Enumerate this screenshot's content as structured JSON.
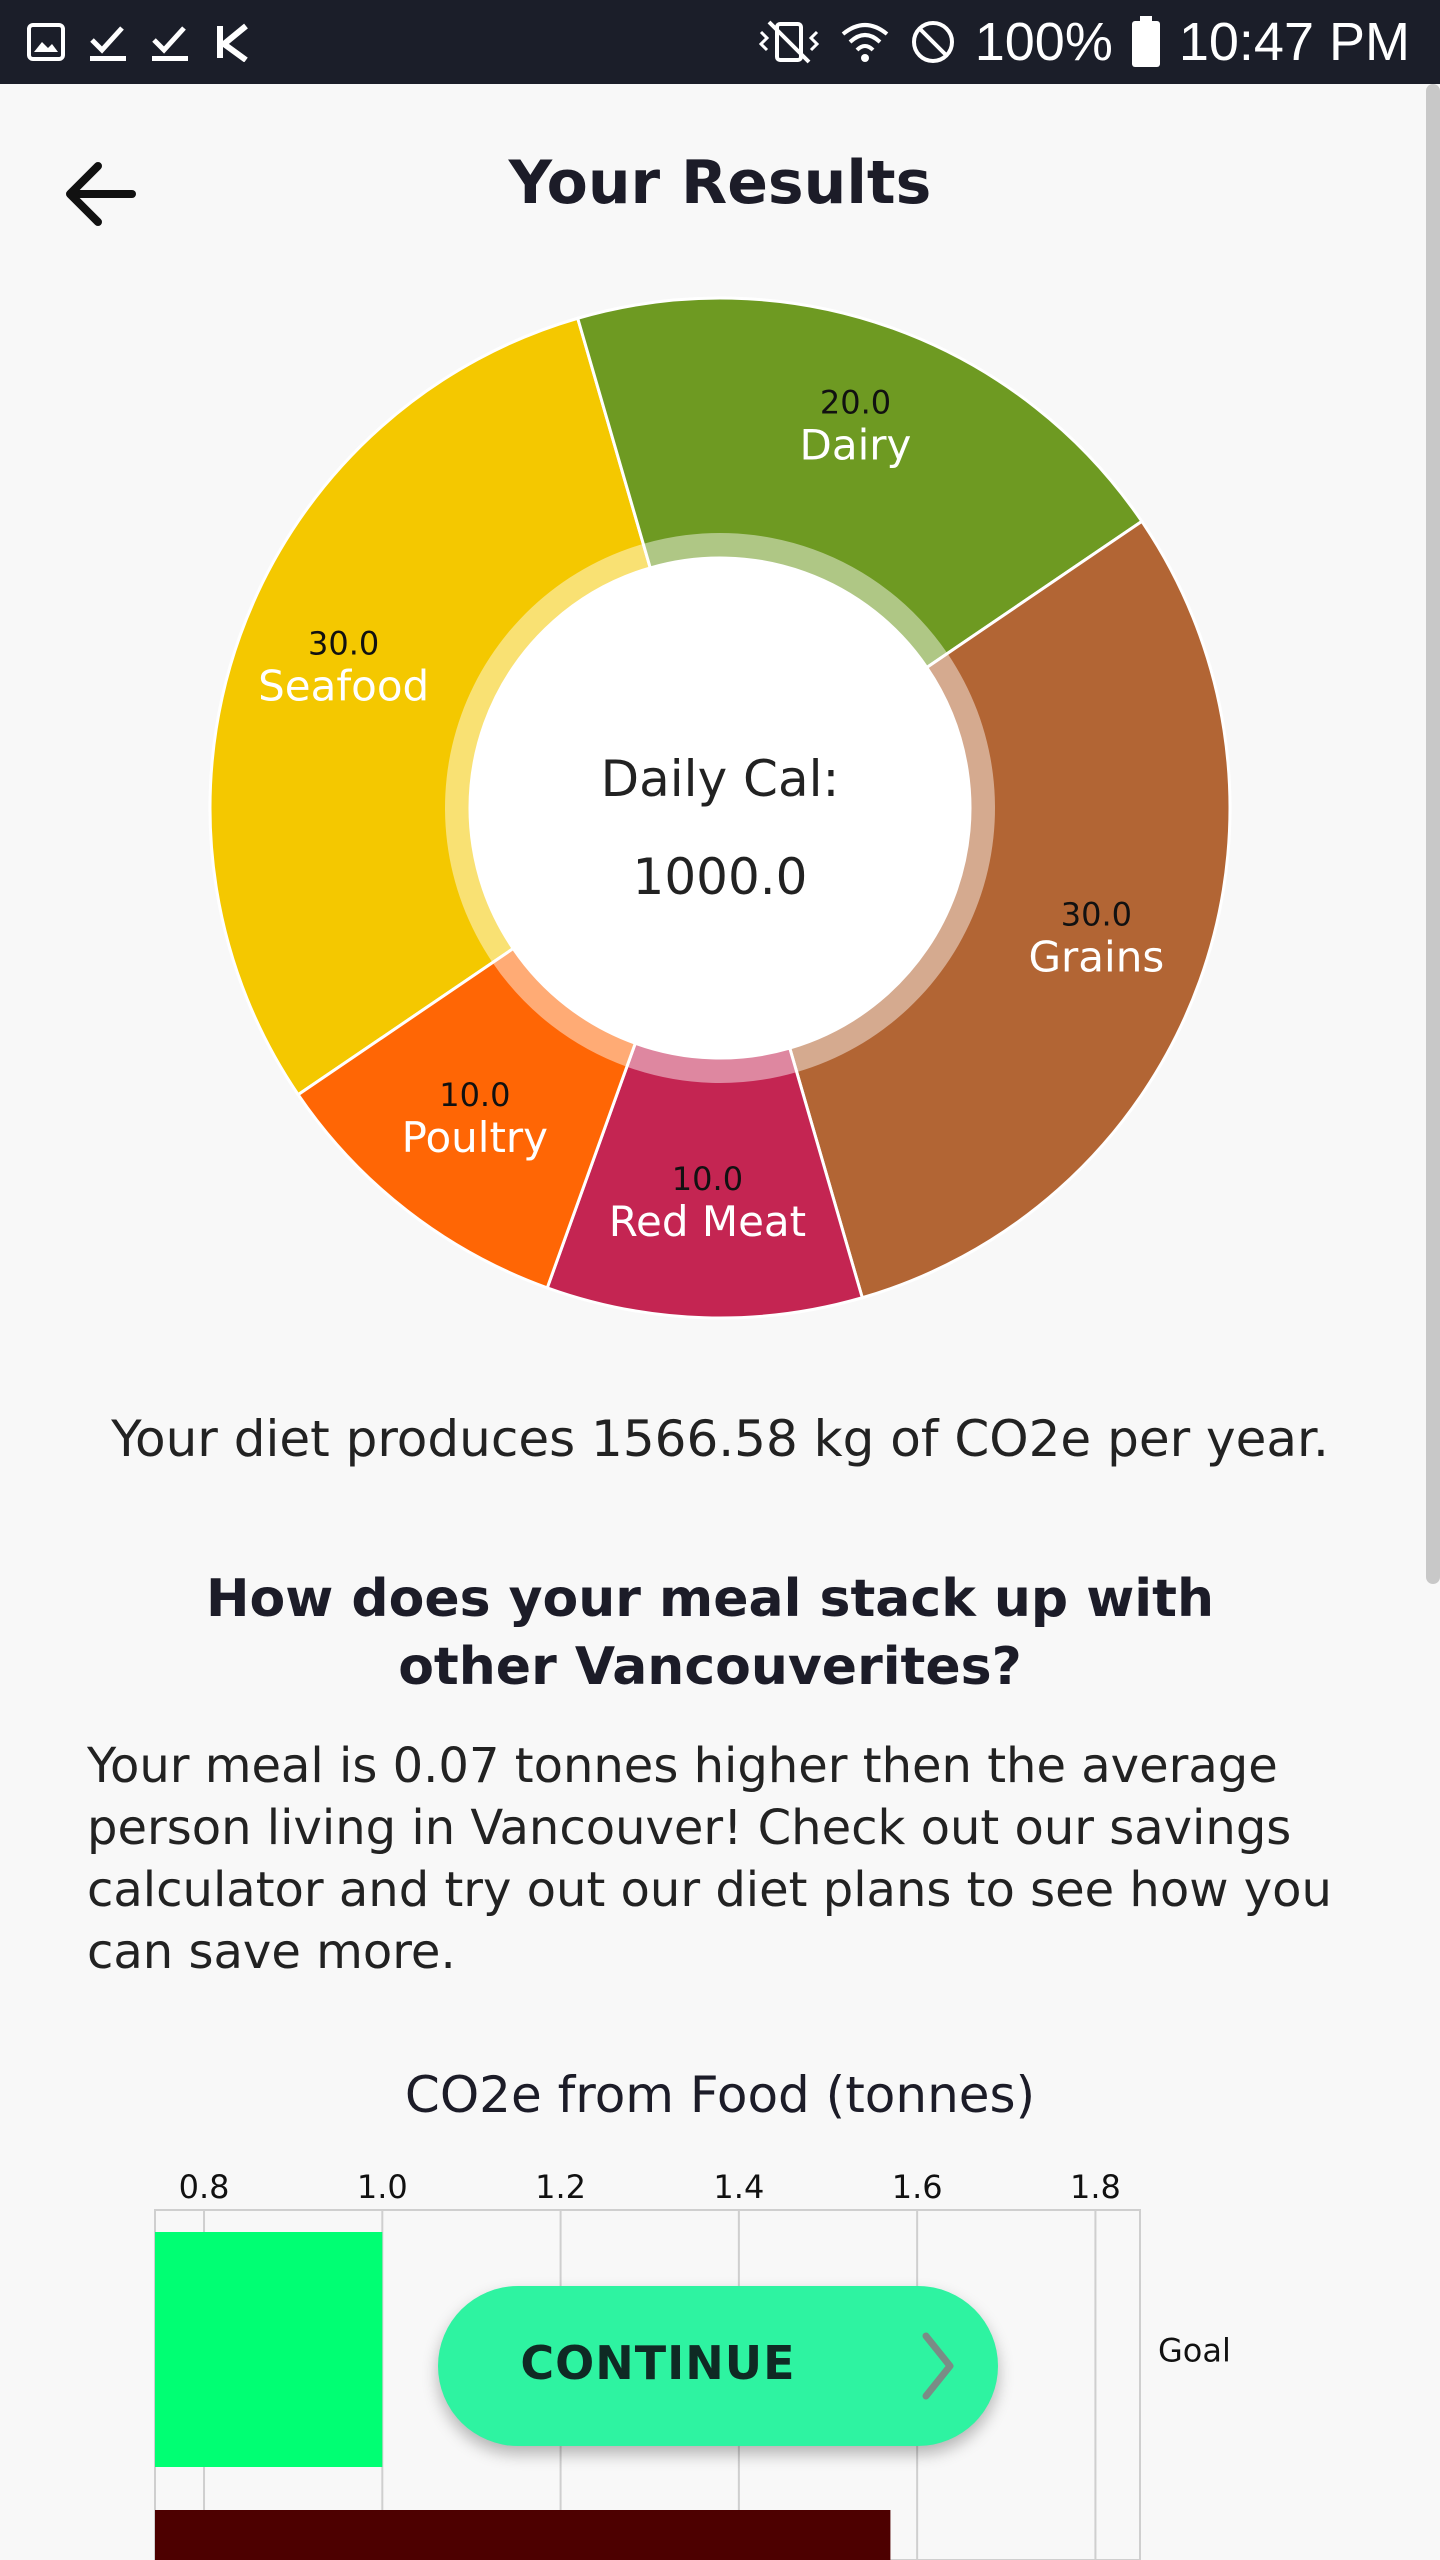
{
  "status_bar": {
    "battery": "100%",
    "time": "10:47 PM",
    "icons": [
      "image-icon",
      "check-icon",
      "check-icon",
      "k-icon",
      "vibrate-mute-icon",
      "wifi-icon",
      "do-not-disturb-icon",
      "battery-icon"
    ]
  },
  "header": {
    "title": "Your Results",
    "back_icon": "arrow-left-icon"
  },
  "donut": {
    "center_line1": "Daily Cal:",
    "center_line2": "1000.0",
    "segments": [
      {
        "name": "Seafood",
        "value": 30.0,
        "value_label": "30.0",
        "color": "#f4c800"
      },
      {
        "name": "Dairy",
        "value": 20.0,
        "value_label": "20.0",
        "color": "#6e9a22"
      },
      {
        "name": "Grains",
        "value": 30.0,
        "value_label": "30.0",
        "color": "#b26534"
      },
      {
        "name": "Red Meat",
        "value": 10.0,
        "value_label": "10.0",
        "color": "#c42552"
      },
      {
        "name": "Poultry",
        "value": 10.0,
        "value_label": "10.0",
        "color": "#ff6605"
      }
    ]
  },
  "summary": {
    "text": "Your diet produces  1566.58  kg of CO2e per year."
  },
  "comparison": {
    "question": "How does your meal stack up with other Vancouverites?",
    "paragraph": "Your meal is 0.07 tonnes higher then the average person living in Vancouver! Check out our savings calculator and try out our diet plans to see how you can save more."
  },
  "chart_data": {
    "type": "bar",
    "orientation": "horizontal",
    "title": "CO2e from Food (tonnes)",
    "x_ticks": [
      "0.8",
      "1.0",
      "1.2",
      "1.4",
      "1.6",
      "1.8"
    ],
    "xlim": [
      0.745,
      1.85
    ],
    "categories": [
      "Goal",
      ""
    ],
    "values": [
      1.0,
      1.57
    ],
    "colors": [
      "#00ff73",
      "#4d0000"
    ],
    "grid": true
  },
  "continue_button": {
    "label": "CONTINUE",
    "icon": "chevron-right-icon"
  }
}
